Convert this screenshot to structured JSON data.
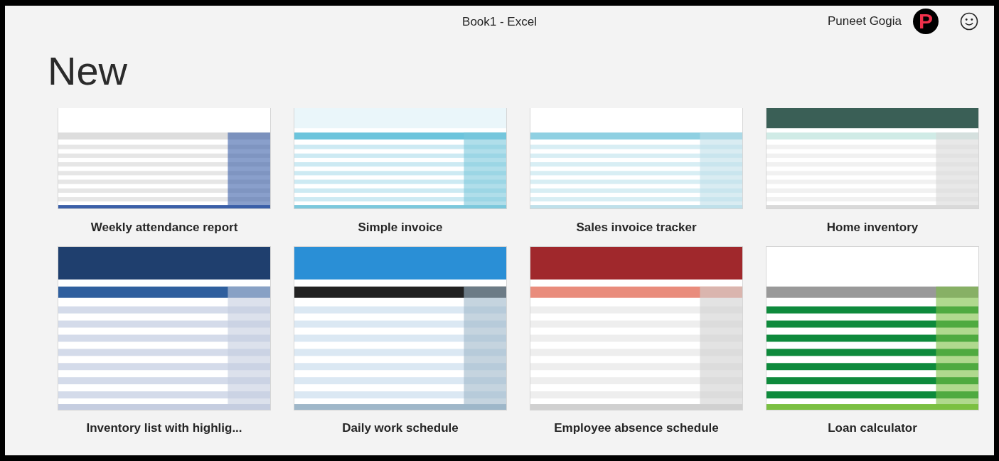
{
  "window": {
    "title": "Book1  -  Excel"
  },
  "user": {
    "name": "Puneet Gogia",
    "initial": "P"
  },
  "heading": "New",
  "templates": [
    {
      "label": "Weekly attendance report"
    },
    {
      "label": "Simple invoice"
    },
    {
      "label": "Sales invoice tracker"
    },
    {
      "label": "Home inventory"
    },
    {
      "label": "Inventory list with highlig..."
    },
    {
      "label": "Daily work schedule"
    },
    {
      "label": "Employee absence schedule"
    },
    {
      "label": "Loan calculator"
    }
  ]
}
